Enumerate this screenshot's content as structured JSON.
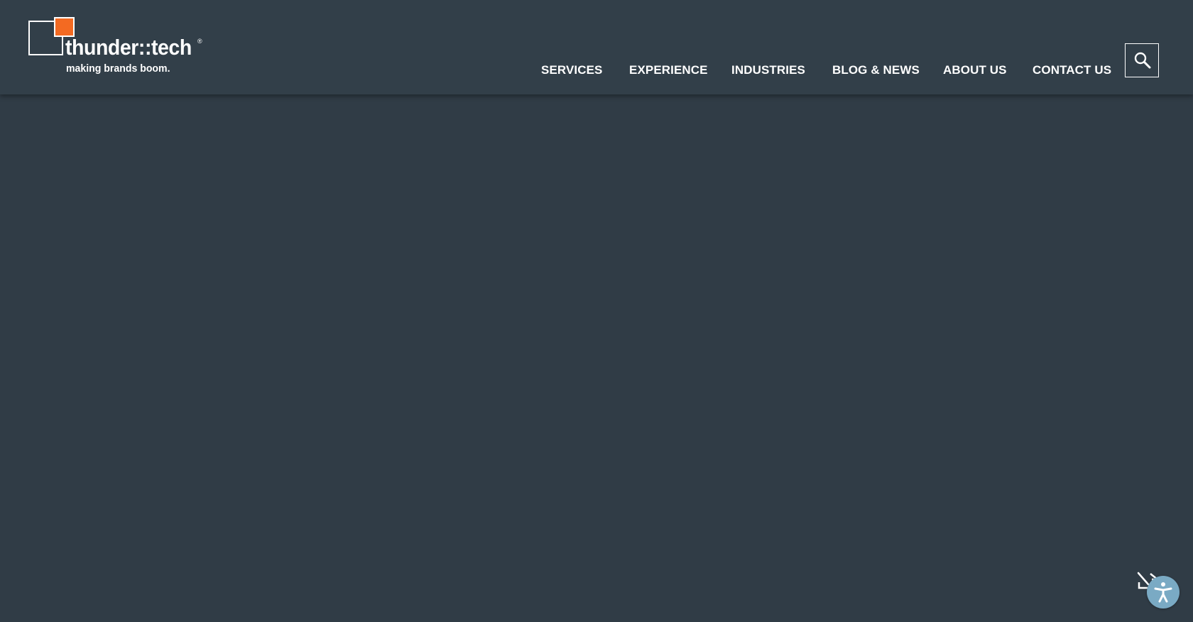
{
  "brand": {
    "wordmark": "thunder::tech",
    "registered_mark": "®",
    "tagline": "making brands boom.",
    "logo_accent_color": "#f36a22"
  },
  "nav": {
    "items": [
      {
        "label": "SERVICES"
      },
      {
        "label": "EXPERIENCE"
      },
      {
        "label": "INDUSTRIES"
      },
      {
        "label": "BLOG & NEWS"
      },
      {
        "label": "ABOUT US"
      },
      {
        "label": "CONTACT US"
      }
    ],
    "search_icon": "search-icon"
  },
  "widgets": {
    "cursor_toggle_icon": "cursor-off-icon",
    "accessibility_icon": "accessibility-icon",
    "accessibility_color": "#7aaac4"
  },
  "colors": {
    "header_bg": "#323f49",
    "page_bg": "#303c46",
    "text": "#ffffff"
  }
}
